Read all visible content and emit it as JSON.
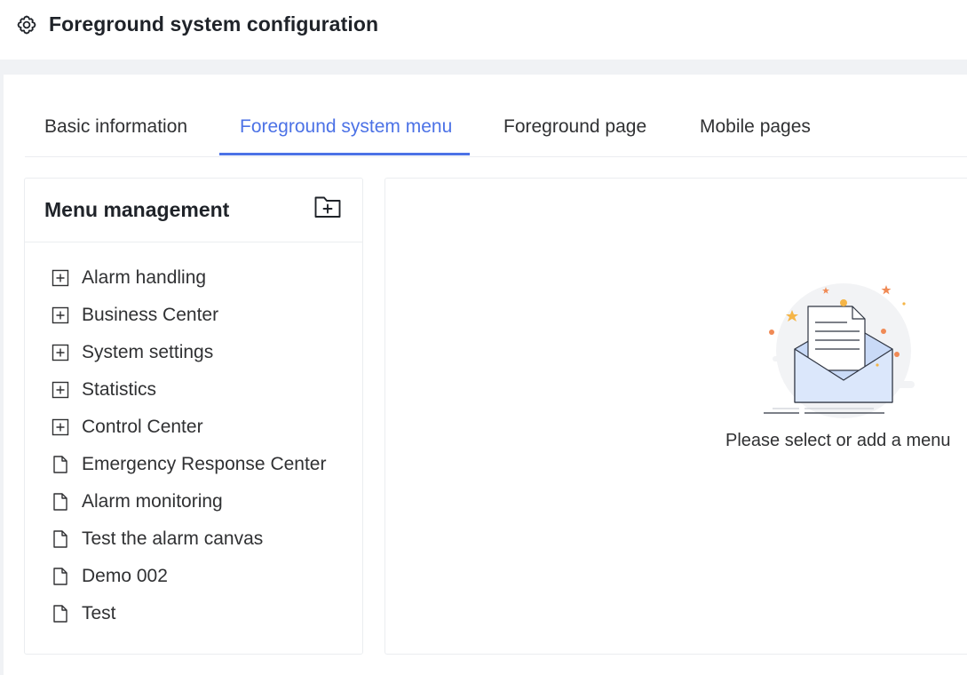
{
  "header": {
    "icon": "gear-icon",
    "title": "Foreground system configuration"
  },
  "tabs": [
    {
      "label": "Basic information",
      "active": false
    },
    {
      "label": "Foreground system menu",
      "active": true
    },
    {
      "label": "Foreground page",
      "active": false
    },
    {
      "label": "Mobile pages",
      "active": false
    }
  ],
  "menu_panel": {
    "title": "Menu management",
    "add_icon": "add-folder-icon",
    "items": [
      {
        "label": "Alarm handling",
        "icon": "expand-plus-icon"
      },
      {
        "label": "Business Center",
        "icon": "expand-plus-icon"
      },
      {
        "label": "System settings",
        "icon": "expand-plus-icon"
      },
      {
        "label": "Statistics",
        "icon": "expand-plus-icon"
      },
      {
        "label": "Control Center",
        "icon": "expand-plus-icon"
      },
      {
        "label": "Emergency Response Center",
        "icon": "document-icon"
      },
      {
        "label": "Alarm monitoring",
        "icon": "document-icon"
      },
      {
        "label": "Test the alarm canvas",
        "icon": "document-icon"
      },
      {
        "label": "Demo 002",
        "icon": "document-icon"
      },
      {
        "label": "Test",
        "icon": "document-icon"
      }
    ]
  },
  "detail_panel": {
    "empty_icon": "empty-envelope-illustration",
    "empty_text": "Please select or add a menu"
  },
  "colors": {
    "accent": "#4c72e6",
    "text": "#303133",
    "border": "#ebedf0",
    "page_bg": "#f0f2f5"
  }
}
